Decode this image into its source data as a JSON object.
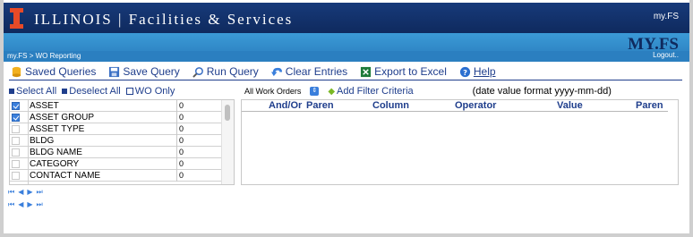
{
  "header": {
    "brand": "ILLINOIS | Facilities & Services",
    "top_right": "my.FS",
    "big_logo": "MY.FS",
    "logout": "Logout..",
    "breadcrumb": "my.FS > WO Reporting"
  },
  "toolbar": {
    "saved_queries": "Saved Queries",
    "save_query": "Save Query",
    "run_query": "Run Query",
    "clear_entries": "Clear Entries",
    "export_excel": "Export to Excel",
    "help": "Help"
  },
  "selection": {
    "select_all": "Select All",
    "deselect_all": "Deselect All",
    "wo_only": "WO Only"
  },
  "filter": {
    "dropdown_value": "All Work Orders",
    "add_filter": "Add Filter Criteria",
    "note": "(date value format yyyy-mm-dd)"
  },
  "columns": [
    {
      "name": "ASSET",
      "checked": true,
      "value": "0"
    },
    {
      "name": "ASSET GROUP",
      "checked": true,
      "value": "0"
    },
    {
      "name": "ASSET TYPE",
      "checked": false,
      "value": "0"
    },
    {
      "name": "BLDG",
      "checked": false,
      "value": "0"
    },
    {
      "name": "BLDG NAME",
      "checked": false,
      "value": "0"
    },
    {
      "name": "CATEGORY",
      "checked": false,
      "value": "0"
    },
    {
      "name": "CONTACT NAME",
      "checked": false,
      "value": "0"
    }
  ],
  "grid_headers": {
    "and_or": "And/Or",
    "paren1": "Paren",
    "column": "Column",
    "operator": "Operator",
    "value": "Value",
    "paren2": "Paren"
  },
  "colors": {
    "dark_blue": "#173a7a",
    "light_blue": "#2b7fc0",
    "link_blue": "#1f3e8c",
    "illinois_orange": "#e84a27"
  }
}
